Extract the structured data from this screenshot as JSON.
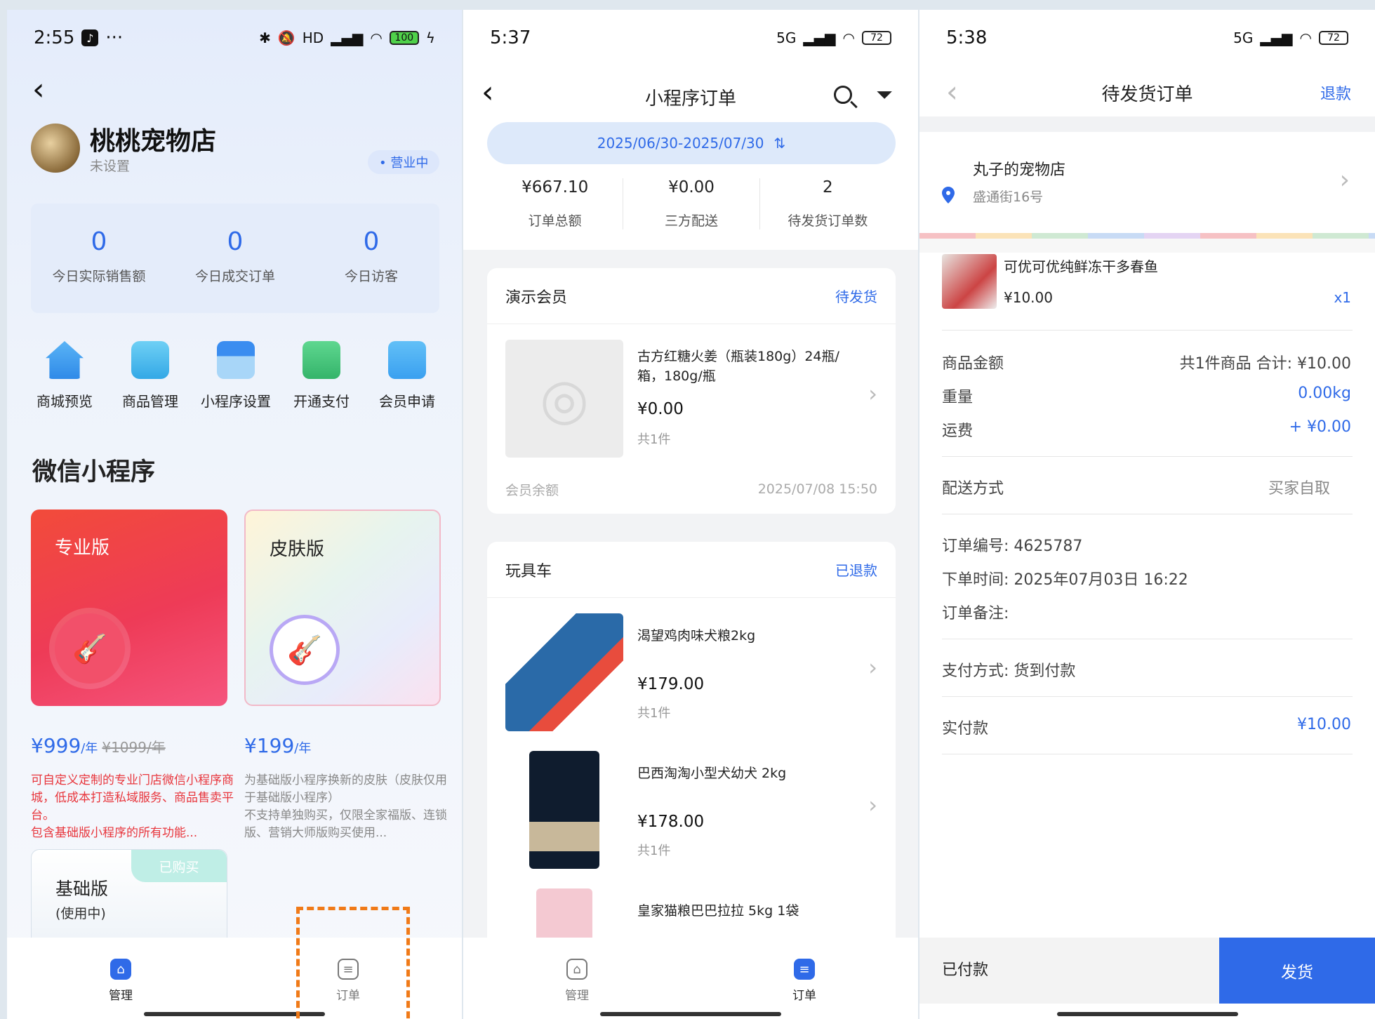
{
  "panel1": {
    "status": {
      "time": "2:55",
      "dots": "···",
      "signal": "HD",
      "battery": "100"
    },
    "shop": {
      "name": "桃桃宠物店",
      "sub": "未设置",
      "badge": "• 营业中"
    },
    "stats": [
      {
        "value": "0",
        "label": "今日实际销售额"
      },
      {
        "value": "0",
        "label": "今日成交订单"
      },
      {
        "value": "0",
        "label": "今日访客"
      }
    ],
    "quick": [
      {
        "label": "商城预览",
        "icon": "store-home-icon",
        "color": "#3aa0f0"
      },
      {
        "label": "商品管理",
        "icon": "shopping-bag-icon",
        "color": "#3ab3e8"
      },
      {
        "label": "小程序设置",
        "icon": "shop-front-icon",
        "color": "#3a8df0"
      },
      {
        "label": "开通支付",
        "icon": "wechat-pay-icon",
        "color": "#4cc67a"
      },
      {
        "label": "会员申请",
        "icon": "member-card-icon",
        "color": "#f5c542"
      }
    ],
    "section_title": "微信小程序",
    "plans": {
      "pro": {
        "label": "专业版",
        "price": "¥999",
        "unit": "/年",
        "old": "¥1099/年",
        "desc": [
          "可自定义定制的专业门店微信小程序商城，低成本打造私域服务、商品售卖平台。",
          "包含基础版小程序的所有功能..."
        ]
      },
      "skin": {
        "label": "皮肤版",
        "price": "¥199",
        "unit": "/年",
        "desc": [
          "为基础版小程序换新的皮肤（皮肤仅用于基础版小程序）",
          "不支持单独购买，仅限全家福版、连锁版、营销大师版购买使用..."
        ]
      },
      "basic": {
        "tag": "已购买",
        "title": "基础版",
        "sub": "(使用中)"
      }
    },
    "tabs": [
      {
        "label": "管理"
      },
      {
        "label": "订单"
      }
    ]
  },
  "panel2": {
    "status": {
      "time": "5:37",
      "signal": "5G",
      "battery": "72"
    },
    "title": "小程序订单",
    "date_range": "2025/06/30-2025/07/30",
    "summary": [
      {
        "value": "¥667.10",
        "label": "订单总额"
      },
      {
        "value": "¥0.00",
        "label": "三方配送"
      },
      {
        "value": "2",
        "label": "待发货订单数"
      }
    ],
    "orders": [
      {
        "customer": "演示会员",
        "status": "待发货",
        "items": [
          {
            "title": "古方红糖火姜（瓶装180g）24瓶/箱，180g/瓶",
            "price": "¥0.00",
            "qty": "共1件"
          }
        ],
        "footer_left": "会员余额",
        "footer_right": "2025/07/08 15:50"
      },
      {
        "customer": "玩具车",
        "status": "已退款",
        "items": [
          {
            "title": "渴望鸡肉味犬粮2kg",
            "price": "¥179.00",
            "qty": "共1件"
          },
          {
            "title": "巴西淘淘小型犬幼犬 2kg",
            "price": "¥178.00",
            "qty": "共1件"
          },
          {
            "title": "皇家猫粮巴巴拉拉 5kg 1袋",
            "price": "",
            "qty": ""
          }
        ]
      }
    ],
    "tabs": [
      {
        "label": "管理"
      },
      {
        "label": "订单"
      }
    ]
  },
  "panel3": {
    "status": {
      "time": "5:38",
      "signal": "5G",
      "battery": "72"
    },
    "title": "待发货订单",
    "refund": "退款",
    "address": {
      "name": "丸子的宠物店",
      "line": "盛通街16号"
    },
    "item": {
      "name": "可优可优纯鲜冻干多春鱼",
      "price": "¥10.00",
      "qty": "x1"
    },
    "rows": {
      "amount_label": "商品金额",
      "amount_value": "共1件商品 合计: ¥10.00",
      "weight_label": "重量",
      "weight_value": "0.00kg",
      "freight_label": "运费",
      "freight_value": "+ ¥0.00",
      "delivery_label": "配送方式",
      "delivery_value": "买家自取",
      "order_no": "订单编号: 4625787",
      "order_time": "下单时间: 2025年07月03日 16:22",
      "order_note": "订单备注:",
      "pay_method": "支付方式: 货到付款",
      "paid_label": "实付款",
      "paid_value": "¥10.00"
    },
    "bottom": {
      "status": "已付款",
      "button": "发货"
    }
  },
  "colors": {
    "accent": "#2f6ae8",
    "highlight": "#f07a18",
    "danger": "#e8363d"
  }
}
